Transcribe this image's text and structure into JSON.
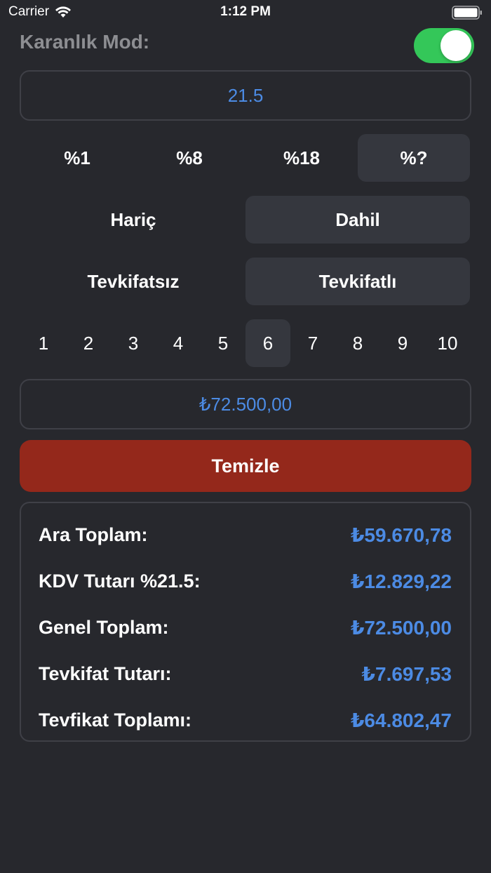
{
  "status_bar": {
    "carrier": "Carrier",
    "time": "1:12 PM",
    "wifi_icon": "wifi-icon",
    "battery_icon": "battery-icon"
  },
  "dark_mode": {
    "label": "Karanlık Mod:",
    "enabled": true,
    "toggle_color": "#34c759"
  },
  "rate_input": {
    "value": "21.5"
  },
  "rate_options": {
    "items": [
      "%1",
      "%8",
      "%18",
      "%?"
    ],
    "selected": "%?"
  },
  "tax_mode": {
    "items": [
      "Hariç",
      "Dahil"
    ],
    "selected": "Dahil"
  },
  "withholding_mode": {
    "items": [
      "Tevkifatsız",
      "Tevkifatlı"
    ],
    "selected": "Tevkifatlı"
  },
  "withholding_ratio": {
    "items": [
      "1",
      "2",
      "3",
      "4",
      "5",
      "6",
      "7",
      "8",
      "9",
      "10"
    ],
    "selected": "6"
  },
  "amount_input": {
    "value": "₺72.500,00"
  },
  "clear_button": {
    "label": "Temizle",
    "color": "#94281b"
  },
  "summary": {
    "rows": [
      {
        "label": "Ara Toplam:",
        "value": "₺59.670,78"
      },
      {
        "label": "KDV Tutarı %21.5:",
        "value": "₺12.829,22"
      },
      {
        "label": "Genel Toplam:",
        "value": "₺72.500,00"
      },
      {
        "label": "Tevkifat Tutarı:",
        "value": "₺7.697,53"
      },
      {
        "label": "Tevfikat Toplamı:",
        "value": "₺64.802,47"
      }
    ]
  },
  "colors": {
    "background": "#27282d",
    "accent": "#4c8be4",
    "selected_segment": "#35373e"
  }
}
